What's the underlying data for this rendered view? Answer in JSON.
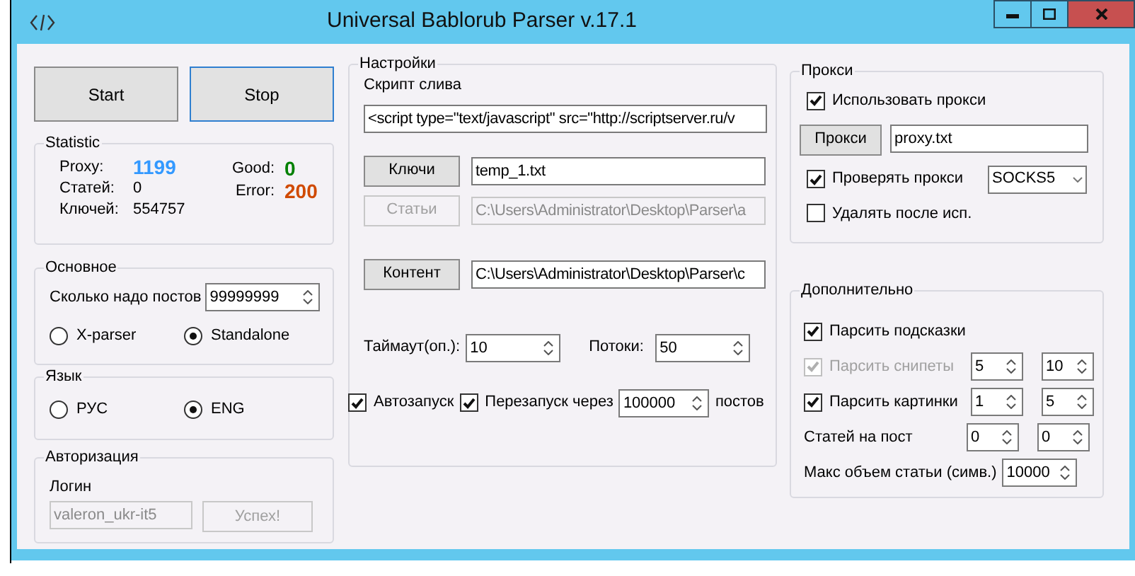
{
  "window": {
    "title": "Universal Bablorub Parser v.17.1"
  },
  "actions": [
    {
      "label": "Start",
      "focused": false
    },
    {
      "label": "Stop",
      "focused": true
    }
  ],
  "statistic": {
    "title": "Statistic",
    "left": [
      {
        "label": "Proxy:",
        "value": "1199",
        "color": "#3399ff"
      },
      {
        "label": "Статей:",
        "value": "0",
        "color": "#000000"
      },
      {
        "label": "Ключей:",
        "value": "554757",
        "color": "#000000"
      }
    ],
    "right": [
      {
        "label": "Good:",
        "value": "0",
        "color": "#008000"
      },
      {
        "label": "Error:",
        "value": "200",
        "color": "#d04a00"
      }
    ]
  },
  "main": {
    "title": "Основное",
    "posts_label": "Сколько надо постов",
    "posts_value": "99999999",
    "modes": [
      {
        "label": "X-parser",
        "selected": false
      },
      {
        "label": "Standalone",
        "selected": true
      }
    ]
  },
  "language": {
    "title": "Язык",
    "options": [
      {
        "label": "РУС",
        "selected": false
      },
      {
        "label": "ENG",
        "selected": true
      }
    ]
  },
  "auth": {
    "title": "Авторизация",
    "login_label": "Логин",
    "login_value": "valeron_ukr-it5",
    "login_disabled": true,
    "button": {
      "label": "Успех!",
      "disabled": true
    }
  },
  "settings": {
    "title": "Настройки",
    "script_label": "Скрипт слива",
    "script_value": "<script type=\"text/javascript\" src=\"http://scriptserver.ru/v",
    "files": [
      {
        "button": "Ключи",
        "value": "temp_1.txt",
        "disabled": false
      },
      {
        "button": "Статьи",
        "value": "C:\\Users\\Administrator\\Desktop\\Parser\\a",
        "disabled": true
      },
      {
        "button": "Контент",
        "value": "C:\\Users\\Administrator\\Desktop\\Parser\\c",
        "disabled": false
      }
    ],
    "timeout_label": "Таймаут(оп.):",
    "timeout_value": "10",
    "threads_label": "Потоки:",
    "threads_value": "50",
    "autostart": {
      "label": "Автозапуск",
      "checked": true
    },
    "restart": {
      "label": "Перезапуск через",
      "checked": true,
      "value": "100000",
      "suffix": "постов"
    }
  },
  "proxy": {
    "title": "Прокси",
    "use": {
      "label": "Использовать прокси",
      "checked": true
    },
    "button": "Прокси",
    "file": "proxy.txt",
    "check": {
      "label": "Проверять прокси",
      "checked": true
    },
    "type": "SOCKS5",
    "delete": {
      "label": "Удалять после исп.",
      "checked": false
    }
  },
  "extra": {
    "title": "Дополнительно",
    "rows": [
      {
        "kind": "check",
        "label": "Парсить подсказки",
        "checked": true,
        "disabled": false
      },
      {
        "kind": "check_range",
        "label": "Парсить снипеты",
        "checked": true,
        "disabled": true,
        "from": "5",
        "to": "10"
      },
      {
        "kind": "check_range",
        "label": "Парсить картинки",
        "checked": true,
        "disabled": false,
        "from": "1",
        "to": "5"
      },
      {
        "kind": "range",
        "label": "Статей на пост",
        "from": "0",
        "to": "0"
      },
      {
        "kind": "number",
        "label": "Макс объем статьи (симв.)",
        "value": "10000"
      }
    ]
  }
}
